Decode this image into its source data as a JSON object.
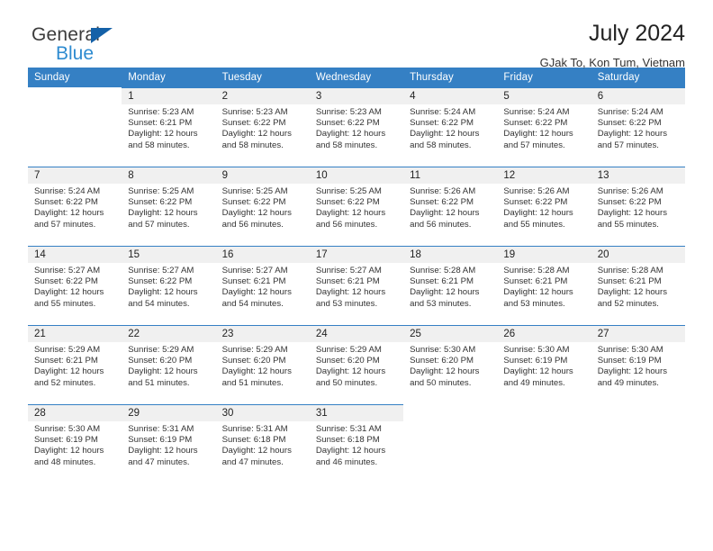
{
  "brand": {
    "name_top": "General",
    "name_bottom": "Blue",
    "flag_icon": "triangle-flag-icon",
    "colors": {
      "top_text": "#3c3c3c",
      "bottom_text": "#2e8bd0",
      "flag": "#1461a8"
    }
  },
  "header": {
    "title": "July 2024",
    "location": "GJak To, Kon Tum, Vietnam"
  },
  "theme": {
    "header_row_bg": "#3580c4",
    "header_row_text": "#ffffff",
    "date_band_bg": "#f0f0f0",
    "week_divider": "#3580c4"
  },
  "weekday_headers": [
    "Sunday",
    "Monday",
    "Tuesday",
    "Wednesday",
    "Thursday",
    "Friday",
    "Saturday"
  ],
  "weeks": [
    {
      "days": [
        {
          "date": "",
          "sunrise": "",
          "sunset": "",
          "daylight_line1": "",
          "daylight_line2": "",
          "empty": true
        },
        {
          "date": "1",
          "sunrise": "Sunrise: 5:23 AM",
          "sunset": "Sunset: 6:21 PM",
          "daylight_line1": "Daylight: 12 hours",
          "daylight_line2": "and 58 minutes.",
          "empty": false
        },
        {
          "date": "2",
          "sunrise": "Sunrise: 5:23 AM",
          "sunset": "Sunset: 6:22 PM",
          "daylight_line1": "Daylight: 12 hours",
          "daylight_line2": "and 58 minutes.",
          "empty": false
        },
        {
          "date": "3",
          "sunrise": "Sunrise: 5:23 AM",
          "sunset": "Sunset: 6:22 PM",
          "daylight_line1": "Daylight: 12 hours",
          "daylight_line2": "and 58 minutes.",
          "empty": false
        },
        {
          "date": "4",
          "sunrise": "Sunrise: 5:24 AM",
          "sunset": "Sunset: 6:22 PM",
          "daylight_line1": "Daylight: 12 hours",
          "daylight_line2": "and 58 minutes.",
          "empty": false
        },
        {
          "date": "5",
          "sunrise": "Sunrise: 5:24 AM",
          "sunset": "Sunset: 6:22 PM",
          "daylight_line1": "Daylight: 12 hours",
          "daylight_line2": "and 57 minutes.",
          "empty": false
        },
        {
          "date": "6",
          "sunrise": "Sunrise: 5:24 AM",
          "sunset": "Sunset: 6:22 PM",
          "daylight_line1": "Daylight: 12 hours",
          "daylight_line2": "and 57 minutes.",
          "empty": false
        }
      ]
    },
    {
      "days": [
        {
          "date": "7",
          "sunrise": "Sunrise: 5:24 AM",
          "sunset": "Sunset: 6:22 PM",
          "daylight_line1": "Daylight: 12 hours",
          "daylight_line2": "and 57 minutes.",
          "empty": false
        },
        {
          "date": "8",
          "sunrise": "Sunrise: 5:25 AM",
          "sunset": "Sunset: 6:22 PM",
          "daylight_line1": "Daylight: 12 hours",
          "daylight_line2": "and 57 minutes.",
          "empty": false
        },
        {
          "date": "9",
          "sunrise": "Sunrise: 5:25 AM",
          "sunset": "Sunset: 6:22 PM",
          "daylight_line1": "Daylight: 12 hours",
          "daylight_line2": "and 56 minutes.",
          "empty": false
        },
        {
          "date": "10",
          "sunrise": "Sunrise: 5:25 AM",
          "sunset": "Sunset: 6:22 PM",
          "daylight_line1": "Daylight: 12 hours",
          "daylight_line2": "and 56 minutes.",
          "empty": false
        },
        {
          "date": "11",
          "sunrise": "Sunrise: 5:26 AM",
          "sunset": "Sunset: 6:22 PM",
          "daylight_line1": "Daylight: 12 hours",
          "daylight_line2": "and 56 minutes.",
          "empty": false
        },
        {
          "date": "12",
          "sunrise": "Sunrise: 5:26 AM",
          "sunset": "Sunset: 6:22 PM",
          "daylight_line1": "Daylight: 12 hours",
          "daylight_line2": "and 55 minutes.",
          "empty": false
        },
        {
          "date": "13",
          "sunrise": "Sunrise: 5:26 AM",
          "sunset": "Sunset: 6:22 PM",
          "daylight_line1": "Daylight: 12 hours",
          "daylight_line2": "and 55 minutes.",
          "empty": false
        }
      ]
    },
    {
      "days": [
        {
          "date": "14",
          "sunrise": "Sunrise: 5:27 AM",
          "sunset": "Sunset: 6:22 PM",
          "daylight_line1": "Daylight: 12 hours",
          "daylight_line2": "and 55 minutes.",
          "empty": false
        },
        {
          "date": "15",
          "sunrise": "Sunrise: 5:27 AM",
          "sunset": "Sunset: 6:22 PM",
          "daylight_line1": "Daylight: 12 hours",
          "daylight_line2": "and 54 minutes.",
          "empty": false
        },
        {
          "date": "16",
          "sunrise": "Sunrise: 5:27 AM",
          "sunset": "Sunset: 6:21 PM",
          "daylight_line1": "Daylight: 12 hours",
          "daylight_line2": "and 54 minutes.",
          "empty": false
        },
        {
          "date": "17",
          "sunrise": "Sunrise: 5:27 AM",
          "sunset": "Sunset: 6:21 PM",
          "daylight_line1": "Daylight: 12 hours",
          "daylight_line2": "and 53 minutes.",
          "empty": false
        },
        {
          "date": "18",
          "sunrise": "Sunrise: 5:28 AM",
          "sunset": "Sunset: 6:21 PM",
          "daylight_line1": "Daylight: 12 hours",
          "daylight_line2": "and 53 minutes.",
          "empty": false
        },
        {
          "date": "19",
          "sunrise": "Sunrise: 5:28 AM",
          "sunset": "Sunset: 6:21 PM",
          "daylight_line1": "Daylight: 12 hours",
          "daylight_line2": "and 53 minutes.",
          "empty": false
        },
        {
          "date": "20",
          "sunrise": "Sunrise: 5:28 AM",
          "sunset": "Sunset: 6:21 PM",
          "daylight_line1": "Daylight: 12 hours",
          "daylight_line2": "and 52 minutes.",
          "empty": false
        }
      ]
    },
    {
      "days": [
        {
          "date": "21",
          "sunrise": "Sunrise: 5:29 AM",
          "sunset": "Sunset: 6:21 PM",
          "daylight_line1": "Daylight: 12 hours",
          "daylight_line2": "and 52 minutes.",
          "empty": false
        },
        {
          "date": "22",
          "sunrise": "Sunrise: 5:29 AM",
          "sunset": "Sunset: 6:20 PM",
          "daylight_line1": "Daylight: 12 hours",
          "daylight_line2": "and 51 minutes.",
          "empty": false
        },
        {
          "date": "23",
          "sunrise": "Sunrise: 5:29 AM",
          "sunset": "Sunset: 6:20 PM",
          "daylight_line1": "Daylight: 12 hours",
          "daylight_line2": "and 51 minutes.",
          "empty": false
        },
        {
          "date": "24",
          "sunrise": "Sunrise: 5:29 AM",
          "sunset": "Sunset: 6:20 PM",
          "daylight_line1": "Daylight: 12 hours",
          "daylight_line2": "and 50 minutes.",
          "empty": false
        },
        {
          "date": "25",
          "sunrise": "Sunrise: 5:30 AM",
          "sunset": "Sunset: 6:20 PM",
          "daylight_line1": "Daylight: 12 hours",
          "daylight_line2": "and 50 minutes.",
          "empty": false
        },
        {
          "date": "26",
          "sunrise": "Sunrise: 5:30 AM",
          "sunset": "Sunset: 6:19 PM",
          "daylight_line1": "Daylight: 12 hours",
          "daylight_line2": "and 49 minutes.",
          "empty": false
        },
        {
          "date": "27",
          "sunrise": "Sunrise: 5:30 AM",
          "sunset": "Sunset: 6:19 PM",
          "daylight_line1": "Daylight: 12 hours",
          "daylight_line2": "and 49 minutes.",
          "empty": false
        }
      ]
    },
    {
      "days": [
        {
          "date": "28",
          "sunrise": "Sunrise: 5:30 AM",
          "sunset": "Sunset: 6:19 PM",
          "daylight_line1": "Daylight: 12 hours",
          "daylight_line2": "and 48 minutes.",
          "empty": false
        },
        {
          "date": "29",
          "sunrise": "Sunrise: 5:31 AM",
          "sunset": "Sunset: 6:19 PM",
          "daylight_line1": "Daylight: 12 hours",
          "daylight_line2": "and 47 minutes.",
          "empty": false
        },
        {
          "date": "30",
          "sunrise": "Sunrise: 5:31 AM",
          "sunset": "Sunset: 6:18 PM",
          "daylight_line1": "Daylight: 12 hours",
          "daylight_line2": "and 47 minutes.",
          "empty": false
        },
        {
          "date": "31",
          "sunrise": "Sunrise: 5:31 AM",
          "sunset": "Sunset: 6:18 PM",
          "daylight_line1": "Daylight: 12 hours",
          "daylight_line2": "and 46 minutes.",
          "empty": false
        },
        {
          "date": "",
          "sunrise": "",
          "sunset": "",
          "daylight_line1": "",
          "daylight_line2": "",
          "empty": true
        },
        {
          "date": "",
          "sunrise": "",
          "sunset": "",
          "daylight_line1": "",
          "daylight_line2": "",
          "empty": true
        },
        {
          "date": "",
          "sunrise": "",
          "sunset": "",
          "daylight_line1": "",
          "daylight_line2": "",
          "empty": true
        }
      ]
    }
  ]
}
